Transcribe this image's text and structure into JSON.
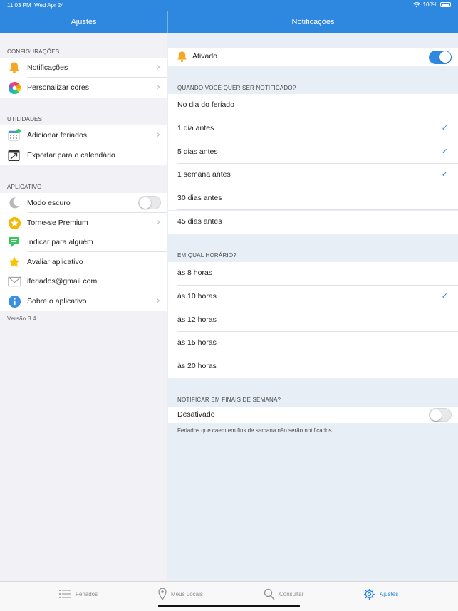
{
  "status": {
    "time": "11:03 PM",
    "date": "Wed Apr 24",
    "battery": "100%"
  },
  "header": {
    "left_title": "Ajustes",
    "right_title": "Notificações"
  },
  "sidebar": {
    "sections": [
      {
        "title": "CONFIGURAÇÕES",
        "items": [
          {
            "label": "Notificações",
            "icon": "bell-icon"
          },
          {
            "label": "Personalizar cores",
            "icon": "color-wheel-icon"
          }
        ]
      },
      {
        "title": "UTILIDADES",
        "items": [
          {
            "label": "Adicionar feriados",
            "icon": "calendar-add-icon"
          },
          {
            "label": "Exportar para o calendário",
            "icon": "calendar-export-icon"
          }
        ]
      },
      {
        "title": "APLICATIVO",
        "items": [
          {
            "label": "Modo escuro",
            "icon": "moon-icon",
            "toggle": false
          },
          {
            "label": "Torne-se Premium",
            "icon": "premium-star-icon"
          },
          {
            "label": "Indicar para alguém",
            "icon": "message-icon"
          },
          {
            "label": "Avaliar aplicativo",
            "icon": "star-icon"
          },
          {
            "label": "iferiados@gmail.com",
            "icon": "mail-icon"
          },
          {
            "label": "Sobre o aplicativo",
            "icon": "info-icon"
          }
        ]
      }
    ],
    "version": "Versão 3.4"
  },
  "notifications": {
    "enabled_label": "Ativado",
    "enabled": true,
    "when_title": "QUANDO VOCÊ QUER SER NOTIFICADO?",
    "when_options": [
      {
        "label": "No dia do feriado",
        "checked": false
      },
      {
        "label": "1 dia antes",
        "checked": true
      },
      {
        "label": "5 dias antes",
        "checked": true
      },
      {
        "label": "1 semana antes",
        "checked": true
      },
      {
        "label": "30 dias antes",
        "checked": false
      },
      {
        "label": "45 dias antes",
        "checked": false
      }
    ],
    "time_title": "EM QUAL HORÁRIO?",
    "time_options": [
      {
        "label": "às 8 horas",
        "checked": false
      },
      {
        "label": "às 10 horas",
        "checked": true
      },
      {
        "label": "às 12 horas",
        "checked": false
      },
      {
        "label": "às 15 horas",
        "checked": false
      },
      {
        "label": "às 20 horas",
        "checked": false
      }
    ],
    "weekend_title": "NOTIFICAR EM FINAIS DE SEMANA?",
    "weekend_label": "Desativado",
    "weekend_enabled": false,
    "weekend_note": "Feriados que caem em fins de semana não serão notificados."
  },
  "tabbar": {
    "tabs": [
      {
        "label": "Feriados",
        "icon": "list-icon"
      },
      {
        "label": "Meus Locais",
        "icon": "location-pin-icon"
      },
      {
        "label": "Consultar",
        "icon": "search-icon"
      },
      {
        "label": "Ajustes",
        "icon": "gear-icon",
        "active": true
      }
    ]
  },
  "colors": {
    "accent": "#2f88e0",
    "bell": "#f5a623"
  }
}
